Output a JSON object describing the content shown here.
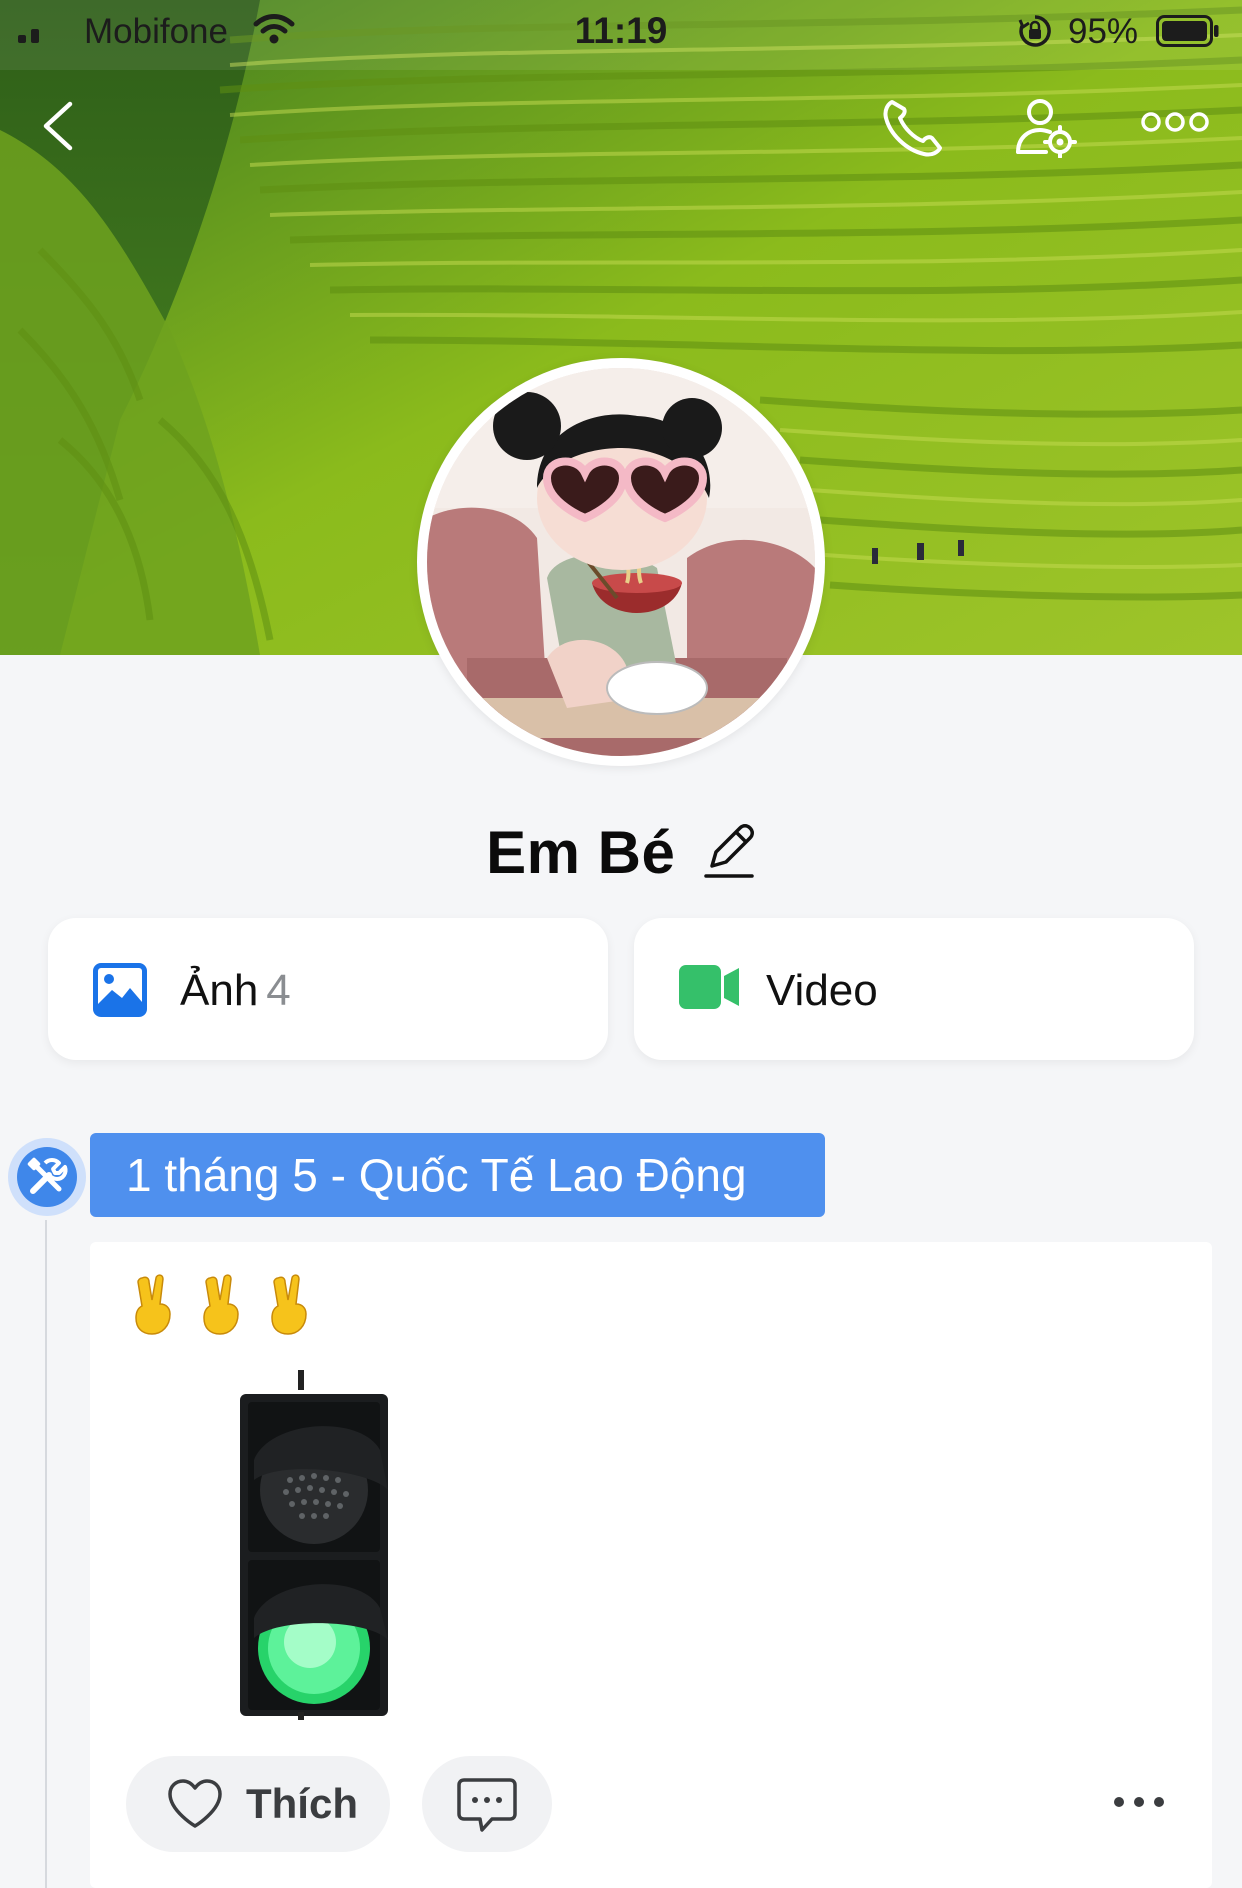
{
  "status_bar": {
    "carrier": "Mobifone",
    "time": "11:19",
    "battery": "95%"
  },
  "nav": {
    "icons": [
      "back-chevron-icon",
      "phone-icon",
      "profile-settings-icon",
      "more-icon"
    ]
  },
  "profile": {
    "name": "Em Bé"
  },
  "media": {
    "photos_label": "Ảnh",
    "photos_count": "4",
    "video_label": "Video"
  },
  "timeline": {
    "event_title": "1 tháng 5 - Quốc Tế Lao Động"
  },
  "post": {
    "emoji_text": "✌️✌️✌️",
    "like_label": "Thích"
  },
  "colors": {
    "accent_blue": "#4f90ee",
    "photo_icon": "#1a73e8",
    "video_icon": "#35c06a"
  }
}
